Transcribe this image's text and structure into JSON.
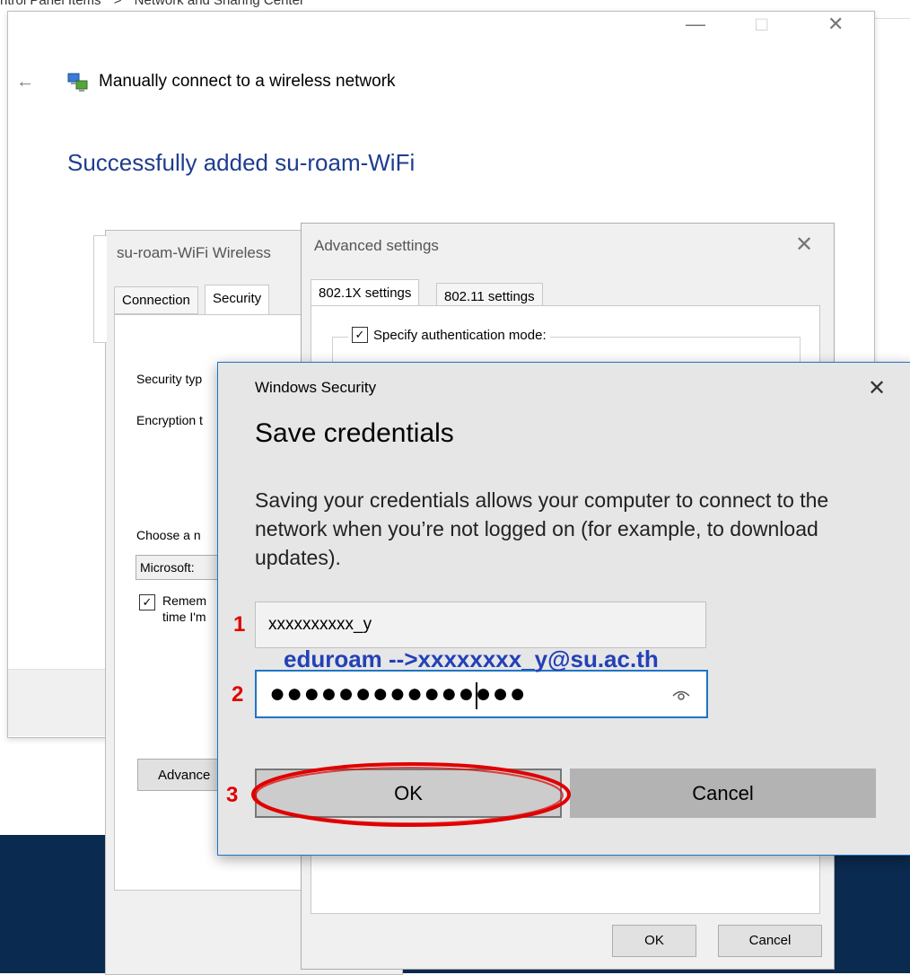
{
  "breadcrumb": [
    "ntrol Panel Items",
    ">",
    "Network and Sharing Center"
  ],
  "main_window": {
    "heading": "Manually connect to a wireless network",
    "success": "Successfully added su-roam-WiFi",
    "controls": {
      "minimize": "—",
      "maximize": "□",
      "close": "✕"
    },
    "back": "←"
  },
  "props_dialog": {
    "title": "su-roam-WiFi Wireless",
    "tabs": [
      "Connection",
      "Security"
    ],
    "labels": {
      "security_type": "Security typ",
      "encryption": "Encryption t",
      "choose": "Choose a n",
      "remember_line1": "Remem",
      "remember_line2": "time I'm"
    },
    "select_value": "Microsoft:",
    "advanced_button": "Advance"
  },
  "advanced_dialog": {
    "title": "Advanced settings",
    "close": "✕",
    "tabs": [
      "802.1X settings",
      "802.11 settings"
    ],
    "specify_auth": "Specify authentication mode:",
    "ok": "OK",
    "cancel": "Cancel"
  },
  "security_dialog": {
    "window_title": "Windows Security",
    "close": "✕",
    "title": "Save credentials",
    "description": "Saving your credentials allows your computer to connect to the network when you’re not logged on (for example, to download updates).",
    "username_value": "xxxxxxxxxx_y",
    "password_dots": "●●●●●●●●●●●●●●●",
    "ok": "OK",
    "cancel": "Cancel"
  },
  "annotations": {
    "step1": "1",
    "step2": "2",
    "step3": "3",
    "hint": "eduroam -->xxxxxxxx_y@su.ac.th"
  },
  "colors": {
    "accent": "#1e74c6",
    "heading_blue": "#1e3d8f",
    "annotation_red": "#e00000",
    "annotation_blue": "#2341b8"
  },
  "icons": {
    "network": "network-icon",
    "eye": "eye-icon",
    "check": "checkmark-icon"
  }
}
